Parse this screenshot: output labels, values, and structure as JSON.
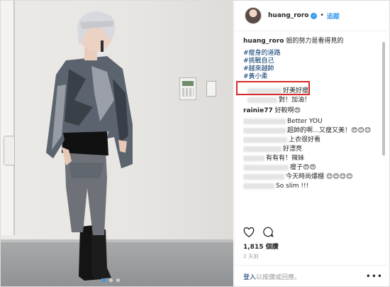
{
  "post": {
    "username": "huang_roro",
    "verified_icon": "verified-badge-icon",
    "separator": "•",
    "follow_label": "追蹤"
  },
  "caption": {
    "username": "huang_roro",
    "text": "姐的努力是看得見的",
    "hashtags": [
      "#瘦身的道路",
      "#挑戰自己",
      "#越來越帥",
      "#黃小柔"
    ]
  },
  "comments": [
    {
      "user": "",
      "text": "好美好瘦"
    },
    {
      "user": "",
      "text": "對！加油！"
    },
    {
      "user": "rainie77",
      "text": "好較啊😍"
    },
    {
      "user": "",
      "text": "Better YOU"
    },
    {
      "user": "",
      "text": "超帥的啊…又瘦又美！😍😊😊"
    },
    {
      "user": "",
      "text": "上衣很好看"
    },
    {
      "user": "",
      "text": "好漂亮"
    },
    {
      "user": "",
      "text": "有有有！辣妹"
    },
    {
      "user": "",
      "text": "瘦子😍😍"
    },
    {
      "user": "",
      "text": "今天時尚爆棚 😊😊😊😊"
    },
    {
      "user": "",
      "text": "So slim !!!"
    }
  ],
  "actions": {
    "like_icon": "heart-icon",
    "comment_icon": "comment-icon"
  },
  "likes": "1,815 個讚",
  "time_ago": "2 天前",
  "login": {
    "link": "登入",
    "rest": "以按讚或回應。",
    "more": "•••"
  },
  "carousel": {
    "count": 3,
    "active_index": 0
  }
}
